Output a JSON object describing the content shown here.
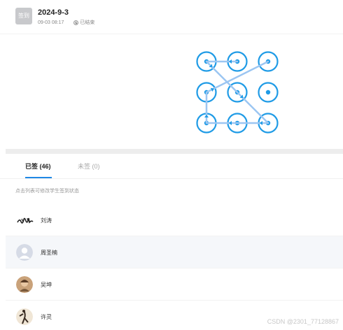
{
  "header": {
    "badge": "签到",
    "title": "2024-9-3",
    "time": "09-03 08:17",
    "status_icon": "clock-icon",
    "status": "已结束"
  },
  "pattern": {
    "accent_color": "#1f9be6",
    "line_color": "#9cc6f2",
    "grid_size": 3,
    "sequence": [
      2,
      1,
      5,
      9,
      8,
      7,
      4,
      3
    ]
  },
  "tabs": [
    {
      "label": "已签 (46)",
      "active": true
    },
    {
      "label": "未签 (0)",
      "active": false
    }
  ],
  "hint": "点击列表可修改学生签到状态",
  "students": [
    {
      "name": "刘涛",
      "avatar": "signature-image",
      "highlight": false
    },
    {
      "name": "周圣楠",
      "avatar": "default-person-avatar",
      "highlight": true
    },
    {
      "name": "吴坤",
      "avatar": "photo-avatar",
      "highlight": false
    },
    {
      "name": "许灵",
      "avatar": "photo-avatar",
      "highlight": false
    }
  ],
  "watermark": "CSDN @2301_77128867"
}
